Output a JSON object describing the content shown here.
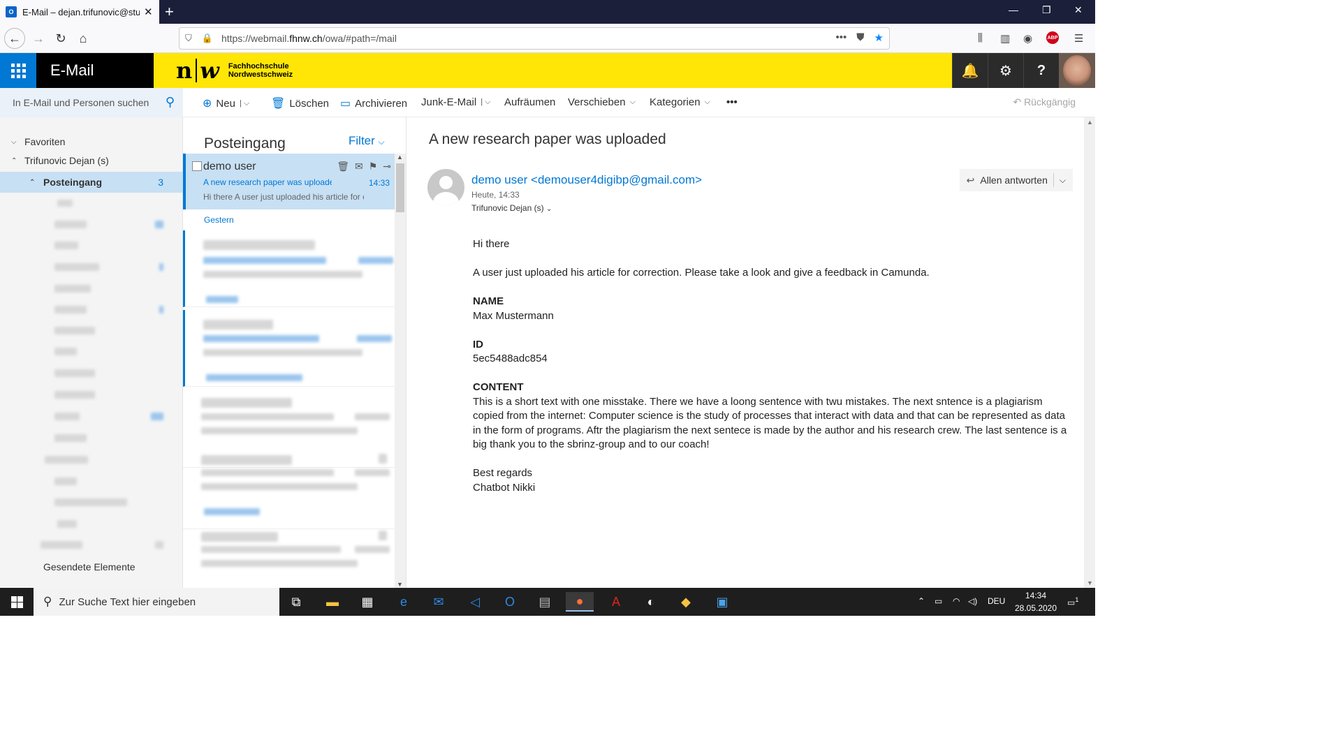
{
  "browser": {
    "tab_title": "E-Mail – dejan.trifunovic@students.fhnw.ch",
    "favicon": "outlook-icon",
    "url_domain_prefix": "https://webmail.",
    "url_domain": "fhnw.ch",
    "url_path": "/owa/#path=/mail",
    "new_tab": "+"
  },
  "owa": {
    "app_name": "E-Mail",
    "logo_mark_left": "n",
    "logo_mark_right": "w",
    "logo_school_line1": "Fachhochschule",
    "logo_school_line2": "Nordwestschweiz",
    "search_placeholder": "In E-Mail und Personen suchen",
    "commands": {
      "new": "Neu",
      "delete": "Löschen",
      "archive": "Archivieren",
      "junk": "Junk-E-Mail",
      "sweep": "Aufräumen",
      "move": "Verschieben",
      "categories": "Kategorien",
      "more": "•••",
      "undo": "Rückgängig"
    },
    "brand_color": "#0078d4",
    "header_color": "#ffe606"
  },
  "folders": {
    "favorites": "Favoriten",
    "account": "Trifunovic Dejan (s)",
    "inbox": "Posteingang",
    "inbox_count": "3",
    "sent": "Gesendete Elemente"
  },
  "message_list": {
    "title": "Posteingang",
    "filter": "Filter",
    "selected": {
      "from": "demo user",
      "subject": "A new research paper was uploaded",
      "time": "14:33",
      "preview": "Hi there A user just uploaded his article for correction."
    },
    "group_yesterday": "Gestern"
  },
  "reading": {
    "subject": "A new research paper was uploaded",
    "from": "demo user <demouser4digibp@gmail.com>",
    "date": "Heute, 14:33",
    "to": "Trifunovic Dejan (s)",
    "reply_all": "Allen antworten",
    "body": {
      "greeting": "Hi there",
      "intro": "A user just uploaded his article for correction. Please take a look and give a feedback in Camunda.",
      "name_label": "NAME",
      "name_value": "Max Mustermann",
      "id_label": "ID",
      "id_value": "5ec5488adc854",
      "content_label": "CONTENT",
      "content_value": "This is a short text with one misstake. There we have a loong sentence with twu mistakes. The next sntence is a plagiarism copied from the internet: Computer science is the study of processes that interact with data and that can be represented as data in the form of programs. Aftr the plagiarism the next sentece is made by the author and his research crew. The last sentence is a big thank you to the sbrinz-group and to our coach!",
      "closing": "Best regards",
      "signature": "Chatbot Nikki"
    }
  },
  "taskbar": {
    "search_placeholder": "Zur Suche Text hier eingeben",
    "language": "DEU",
    "time": "14:34",
    "date": "28.05.2020",
    "notification_count": "1"
  }
}
